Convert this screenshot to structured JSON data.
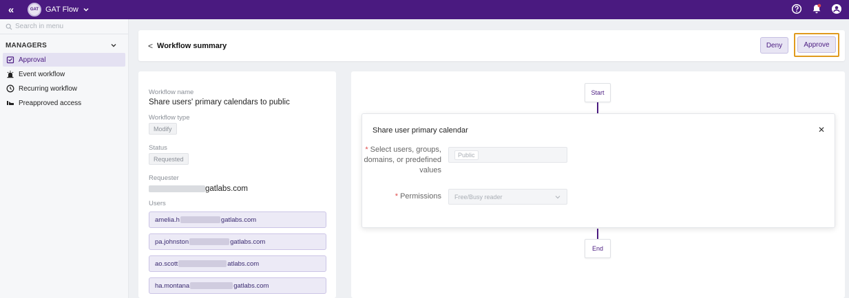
{
  "topbar": {
    "app_name": "GAT Flow",
    "logo_text": "GAT",
    "icons": [
      "collapse-icon",
      "help-icon",
      "notification-bell-icon",
      "account-icon"
    ],
    "accent": "#4a1a80",
    "notification_dot": "#e0484a"
  },
  "sidebar": {
    "search_placeholder": "Search in menu",
    "section_label": "MANAGERS",
    "items": [
      {
        "label": "Approval",
        "icon": "approval-icon",
        "active": true
      },
      {
        "label": "Event workflow",
        "icon": "event-icon",
        "active": false
      },
      {
        "label": "Recurring workflow",
        "icon": "clock-icon",
        "active": false
      },
      {
        "label": "Preapproved access",
        "icon": "preapproved-icon",
        "active": false
      }
    ]
  },
  "header": {
    "title": "Workflow summary",
    "deny_label": "Deny",
    "approve_label": "Approve",
    "highlight_color": "#e09a1d"
  },
  "details": {
    "workflow_name_label": "Workflow name",
    "workflow_name": "Share users' primary calendars to public",
    "workflow_type_label": "Workflow type",
    "workflow_type": "Modify",
    "status_label": "Status",
    "status": "Requested",
    "requester_label": "Requester",
    "requester_domain": "gatlabs.com",
    "users_label": "Users",
    "users": [
      {
        "prefix": "amelia.h",
        "suffix": "gatlabs.com"
      },
      {
        "prefix": "pa.johnston",
        "suffix": "gatlabs.com"
      },
      {
        "prefix": "ao.scott",
        "suffix": "atlabs.com"
      },
      {
        "prefix": "ha.montana",
        "suffix": "gatlabs.com"
      }
    ]
  },
  "workflow": {
    "start_label": "Start",
    "end_label": "End",
    "step_title": "Share user primary calendar",
    "fields": [
      {
        "required_mark": "*",
        "label": "Select users, groups, domains, or predefined values",
        "value": "Public"
      },
      {
        "required_mark": "*",
        "label": "Permissions",
        "value": "Free/Busy reader"
      }
    ]
  }
}
